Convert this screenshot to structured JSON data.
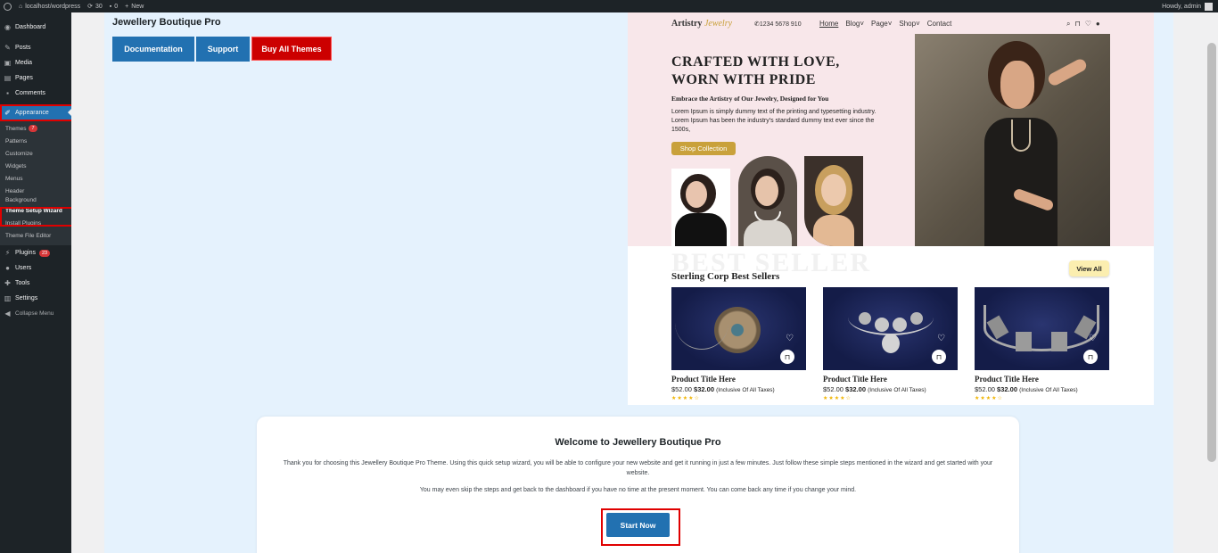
{
  "adminbar": {
    "site": "localhost/wordpress",
    "updates": "30",
    "comments": "0",
    "new_label": "New",
    "greeting": "Howdy, admin"
  },
  "sidebar": {
    "dashboard": "Dashboard",
    "posts": "Posts",
    "media": "Media",
    "pages": "Pages",
    "comments": "Comments",
    "appearance": "Appearance",
    "submenu": {
      "themes": "Themes",
      "themes_badge": "7",
      "patterns": "Patterns",
      "customize": "Customize",
      "widgets": "Widgets",
      "menus": "Menus",
      "header": "Header",
      "background": "Background",
      "wizard": "Theme Setup Wizard",
      "install_plugins": "Install Plugins",
      "file_editor": "Theme File Editor"
    },
    "plugins": "Plugins",
    "plugins_badge": "23",
    "users": "Users",
    "tools": "Tools",
    "settings": "Settings",
    "collapse": "Collapse Menu"
  },
  "header": {
    "theme_title": "Jewellery Boutique Pro",
    "btn_docs": "Documentation",
    "btn_support": "Support",
    "btn_buy": "Buy All Themes"
  },
  "preview": {
    "logo_a": "Artistry",
    "logo_b": "Jewelry",
    "phone": "1234 5678 910",
    "menu": [
      "Home",
      "Blog",
      "Page",
      "Shop",
      "Contact"
    ],
    "hero_line1": "CRAFTED WITH LOVE,",
    "hero_line2": "WORN WITH PRIDE",
    "hero_sub": "Embrace the Artistry of Our Jewelry, Designed for You",
    "hero_lorem": "Lorem Ipsum is simply dummy text of the printing and typesetting industry. Lorem Ipsum has been the industry's standard dummy text ever since the 1500s,",
    "shop_btn": "Shop Collection",
    "bs_bg": "BEST SELLER",
    "bs_title": "Sterling Corp Best Sellers",
    "view_all": "View All",
    "products": [
      {
        "title": "Product Title Here",
        "old_price": "$52.00",
        "price": "$32.00",
        "tax": "(Inclusive Of All Taxes)",
        "stars": "★★★★☆"
      },
      {
        "title": "Product Title Here",
        "old_price": "$52.00",
        "price": "$32.00",
        "tax": "(Inclusive Of All Taxes)",
        "stars": "★★★★☆"
      },
      {
        "title": "Product Title Here",
        "old_price": "$52.00",
        "price": "$32.00",
        "tax": "(Inclusive Of All Taxes)",
        "stars": "★★★★☆"
      }
    ]
  },
  "welcome": {
    "title": "Welcome to Jewellery Boutique Pro",
    "p1": "Thank you for choosing this Jewellery Boutique Pro Theme. Using this quick setup wizard, you will be able to configure your new website and get it running in just a few minutes. Just follow these simple steps mentioned in the wizard and get started with your website.",
    "p2": "You may even skip the steps and get back to the dashboard if you have no time at the present moment. You can come back any time if you change your mind.",
    "start_btn": "Start Now"
  },
  "colors": {
    "wp_blue": "#2271b1",
    "highlight_red": "#e00000",
    "admin_dark": "#1d2327",
    "gold": "#c9a13b"
  }
}
